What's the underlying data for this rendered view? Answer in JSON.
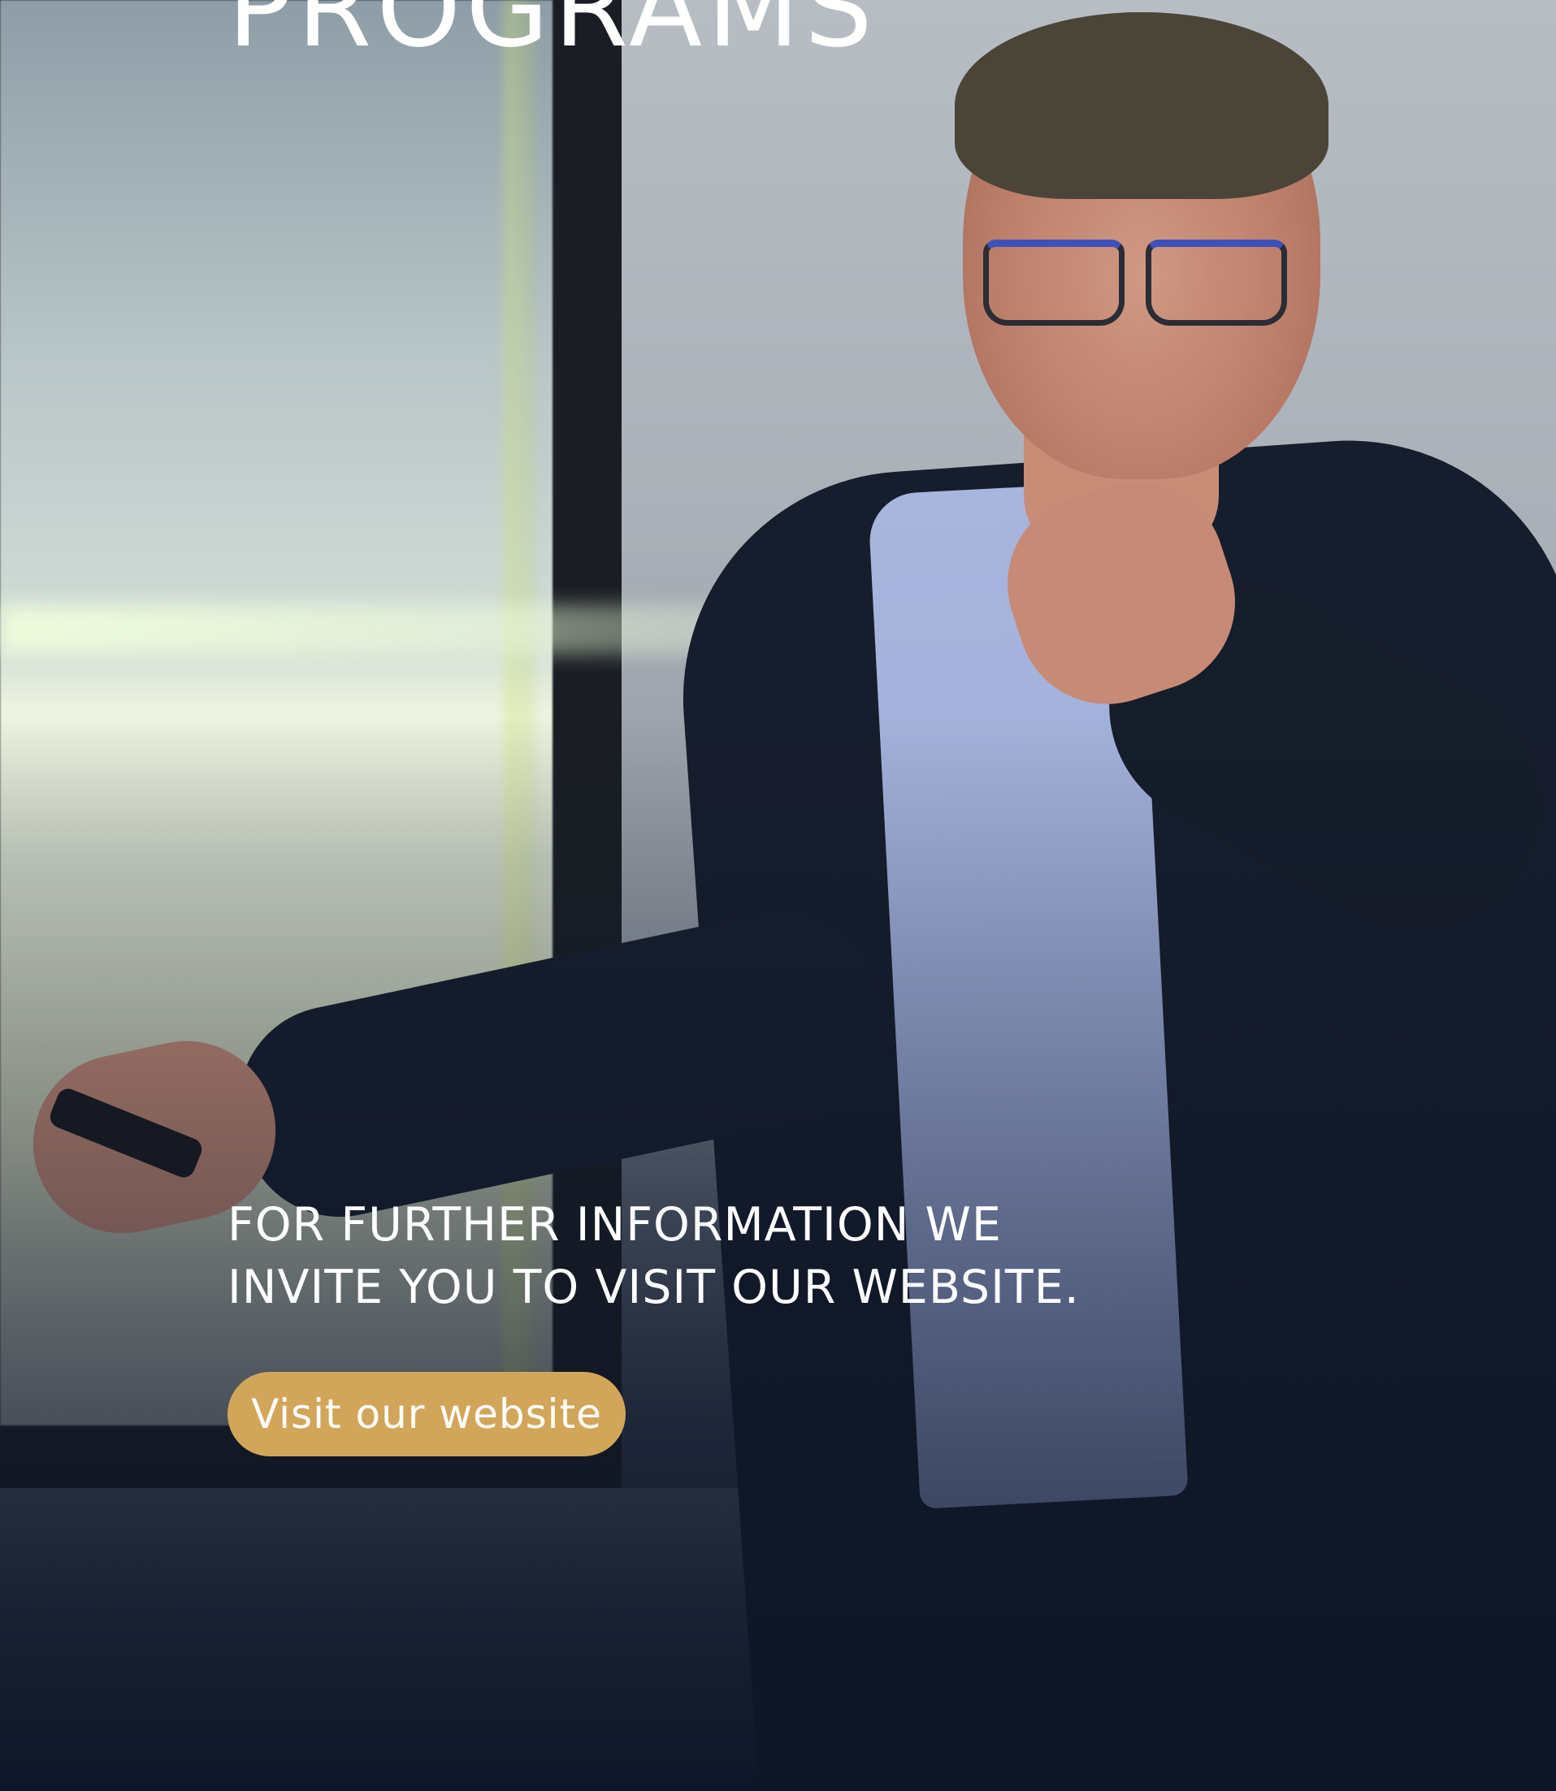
{
  "hero": {
    "heading": "PROGRAMS",
    "info_line_1": "FOR FURTHER INFORMATION WE",
    "info_line_2": "INVITE YOU TO VISIT OUR WEBSITE.",
    "cta_label": "Visit our website"
  },
  "colors": {
    "cta_background": "#d2a65a",
    "text": "#ffffff",
    "overlay_dark": "#101a2d"
  }
}
